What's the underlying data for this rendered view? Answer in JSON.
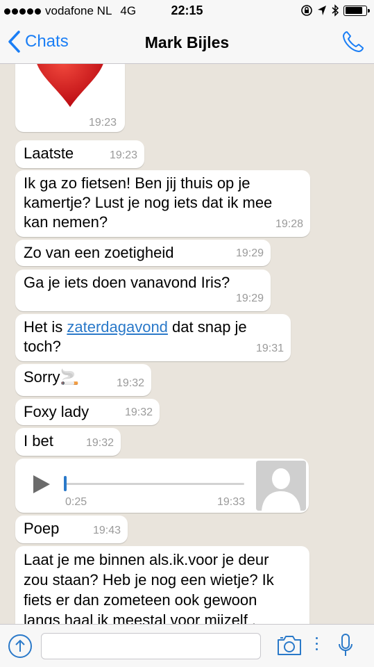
{
  "status": {
    "carrier": "vodafone NL",
    "network": "4G",
    "time": "22:15",
    "battery_level": 0.85
  },
  "nav": {
    "back_label": "Chats",
    "title": "Mark Bijles"
  },
  "messages": [
    {
      "time": "19:23"
    },
    {
      "text": "Laatste",
      "time": "19:23"
    },
    {
      "lines": [
        "Ik ga zo fietsen! Ben jij thuis op je",
        "kamertje? Lust je nog iets dat ik mee",
        "kan nemen?"
      ],
      "time": "19:28"
    },
    {
      "text": "Zo van een zoetigheid",
      "time": "19:29"
    },
    {
      "text": "Ga je iets doen vanavond Iris?",
      "time": "19:29"
    },
    {
      "prefix": "Het is ",
      "link": "zaterdagavond",
      "suffix": " dat snap je",
      "line2": "toch?",
      "time": "19:31"
    },
    {
      "text": "Sorry🚬",
      "time": "19:32"
    },
    {
      "text": "Foxy lady",
      "time": "19:32"
    },
    {
      "text": "I bet",
      "time": "19:32"
    },
    {
      "duration": "0:25",
      "time": "19:33",
      "progress": 0.0
    },
    {
      "text": "Poep",
      "time": "19:43"
    },
    {
      "lines": [
        "Laat je me binnen als.ik.voor je deur",
        "zou staan? Heb je nog een wietje? Ik",
        "fiets er dan zometeen ook gewoon",
        "langs haal ik meestal voor mijzelf ."
      ]
    }
  ],
  "input": {
    "placeholder": ""
  },
  "colors": {
    "accent": "#1a7ef5",
    "link": "#2a79c9",
    "heart": "#d10f16",
    "chat_bg": "#e9e4dc"
  }
}
